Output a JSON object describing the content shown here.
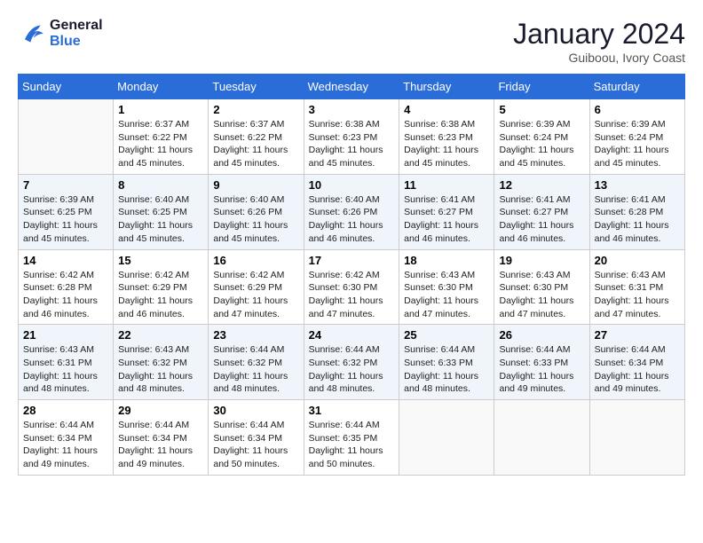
{
  "header": {
    "logo_line1": "General",
    "logo_line2": "Blue",
    "month": "January 2024",
    "location": "Guiboou, Ivory Coast"
  },
  "weekdays": [
    "Sunday",
    "Monday",
    "Tuesday",
    "Wednesday",
    "Thursday",
    "Friday",
    "Saturday"
  ],
  "weeks": [
    [
      {
        "day": null
      },
      {
        "day": "1",
        "sunrise": "6:37 AM",
        "sunset": "6:22 PM",
        "daylight": "11 hours and 45 minutes."
      },
      {
        "day": "2",
        "sunrise": "6:37 AM",
        "sunset": "6:22 PM",
        "daylight": "11 hours and 45 minutes."
      },
      {
        "day": "3",
        "sunrise": "6:38 AM",
        "sunset": "6:23 PM",
        "daylight": "11 hours and 45 minutes."
      },
      {
        "day": "4",
        "sunrise": "6:38 AM",
        "sunset": "6:23 PM",
        "daylight": "11 hours and 45 minutes."
      },
      {
        "day": "5",
        "sunrise": "6:39 AM",
        "sunset": "6:24 PM",
        "daylight": "11 hours and 45 minutes."
      },
      {
        "day": "6",
        "sunrise": "6:39 AM",
        "sunset": "6:24 PM",
        "daylight": "11 hours and 45 minutes."
      }
    ],
    [
      {
        "day": "7",
        "sunrise": "6:39 AM",
        "sunset": "6:25 PM",
        "daylight": "11 hours and 45 minutes."
      },
      {
        "day": "8",
        "sunrise": "6:40 AM",
        "sunset": "6:25 PM",
        "daylight": "11 hours and 45 minutes."
      },
      {
        "day": "9",
        "sunrise": "6:40 AM",
        "sunset": "6:26 PM",
        "daylight": "11 hours and 45 minutes."
      },
      {
        "day": "10",
        "sunrise": "6:40 AM",
        "sunset": "6:26 PM",
        "daylight": "11 hours and 46 minutes."
      },
      {
        "day": "11",
        "sunrise": "6:41 AM",
        "sunset": "6:27 PM",
        "daylight": "11 hours and 46 minutes."
      },
      {
        "day": "12",
        "sunrise": "6:41 AM",
        "sunset": "6:27 PM",
        "daylight": "11 hours and 46 minutes."
      },
      {
        "day": "13",
        "sunrise": "6:41 AM",
        "sunset": "6:28 PM",
        "daylight": "11 hours and 46 minutes."
      }
    ],
    [
      {
        "day": "14",
        "sunrise": "6:42 AM",
        "sunset": "6:28 PM",
        "daylight": "11 hours and 46 minutes."
      },
      {
        "day": "15",
        "sunrise": "6:42 AM",
        "sunset": "6:29 PM",
        "daylight": "11 hours and 46 minutes."
      },
      {
        "day": "16",
        "sunrise": "6:42 AM",
        "sunset": "6:29 PM",
        "daylight": "11 hours and 47 minutes."
      },
      {
        "day": "17",
        "sunrise": "6:42 AM",
        "sunset": "6:30 PM",
        "daylight": "11 hours and 47 minutes."
      },
      {
        "day": "18",
        "sunrise": "6:43 AM",
        "sunset": "6:30 PM",
        "daylight": "11 hours and 47 minutes."
      },
      {
        "day": "19",
        "sunrise": "6:43 AM",
        "sunset": "6:30 PM",
        "daylight": "11 hours and 47 minutes."
      },
      {
        "day": "20",
        "sunrise": "6:43 AM",
        "sunset": "6:31 PM",
        "daylight": "11 hours and 47 minutes."
      }
    ],
    [
      {
        "day": "21",
        "sunrise": "6:43 AM",
        "sunset": "6:31 PM",
        "daylight": "11 hours and 48 minutes."
      },
      {
        "day": "22",
        "sunrise": "6:43 AM",
        "sunset": "6:32 PM",
        "daylight": "11 hours and 48 minutes."
      },
      {
        "day": "23",
        "sunrise": "6:44 AM",
        "sunset": "6:32 PM",
        "daylight": "11 hours and 48 minutes."
      },
      {
        "day": "24",
        "sunrise": "6:44 AM",
        "sunset": "6:32 PM",
        "daylight": "11 hours and 48 minutes."
      },
      {
        "day": "25",
        "sunrise": "6:44 AM",
        "sunset": "6:33 PM",
        "daylight": "11 hours and 48 minutes."
      },
      {
        "day": "26",
        "sunrise": "6:44 AM",
        "sunset": "6:33 PM",
        "daylight": "11 hours and 49 minutes."
      },
      {
        "day": "27",
        "sunrise": "6:44 AM",
        "sunset": "6:34 PM",
        "daylight": "11 hours and 49 minutes."
      }
    ],
    [
      {
        "day": "28",
        "sunrise": "6:44 AM",
        "sunset": "6:34 PM",
        "daylight": "11 hours and 49 minutes."
      },
      {
        "day": "29",
        "sunrise": "6:44 AM",
        "sunset": "6:34 PM",
        "daylight": "11 hours and 49 minutes."
      },
      {
        "day": "30",
        "sunrise": "6:44 AM",
        "sunset": "6:34 PM",
        "daylight": "11 hours and 50 minutes."
      },
      {
        "day": "31",
        "sunrise": "6:44 AM",
        "sunset": "6:35 PM",
        "daylight": "11 hours and 50 minutes."
      },
      {
        "day": null
      },
      {
        "day": null
      },
      {
        "day": null
      }
    ]
  ]
}
